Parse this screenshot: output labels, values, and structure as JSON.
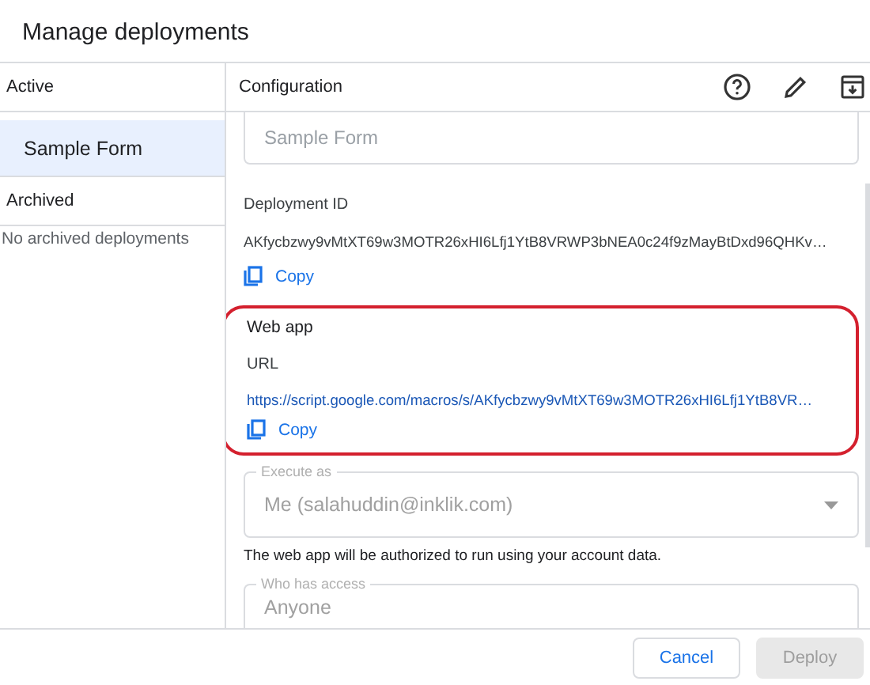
{
  "dialog": {
    "title": "Manage deployments"
  },
  "sidebar": {
    "active_heading": "Active",
    "items": [
      {
        "label": "Sample Form",
        "selected": true
      }
    ],
    "archived_heading": "Archived",
    "archived_empty": "No archived deployments"
  },
  "config": {
    "heading": "Configuration",
    "description_field": {
      "placeholder": "Sample Form"
    },
    "deployment_id": {
      "label": "Deployment ID",
      "value": "AKfycbzwy9vMtXT69w3MOTR26xHI6Lfj1YtB8VRWP3bNEA0c24f9zMayBtDxd96QHKv…",
      "copy": "Copy"
    },
    "web_app": {
      "heading": "Web app",
      "url_label": "URL",
      "url": "https://script.google.com/macros/s/AKfycbzwy9vMtXT69w3MOTR26xHI6Lfj1YtB8VR…",
      "copy": "Copy",
      "highlighted": true
    },
    "execute_as": {
      "label": "Execute as",
      "value": "Me (salahuddin@inklik.com)",
      "disabled": true,
      "hint": "The web app will be authorized to run using your account data."
    },
    "who_has_access": {
      "label": "Who has access",
      "value": "Anyone",
      "disabled": true
    }
  },
  "buttons": [
    {
      "label": "Cancel",
      "disabled": false
    },
    {
      "label": "Deploy",
      "disabled": true
    }
  ]
}
